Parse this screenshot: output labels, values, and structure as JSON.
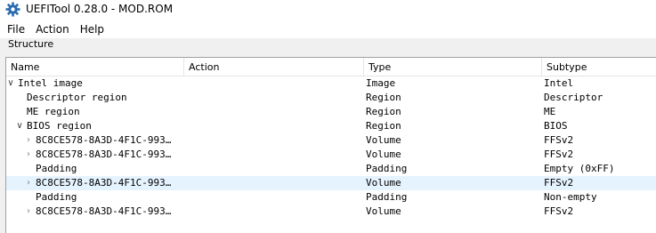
{
  "window": {
    "title": "UEFITool 0.28.0 - MOD.ROM"
  },
  "menu": {
    "items": [
      "File",
      "Action",
      "Help"
    ]
  },
  "structure": {
    "group_label": "Structure",
    "columns": [
      "Name",
      "Action",
      "Type",
      "Subtype"
    ],
    "rows": [
      {
        "name": "Intel image",
        "action": "",
        "type": "Image",
        "subtype": "Intel",
        "expander": "expanded",
        "selected": false
      },
      {
        "name": "Descriptor region",
        "action": "",
        "type": "Region",
        "subtype": "Descriptor",
        "expander": "none",
        "selected": false
      },
      {
        "name": "ME region",
        "action": "",
        "type": "Region",
        "subtype": "ME",
        "expander": "none",
        "selected": false
      },
      {
        "name": "BIOS region",
        "action": "",
        "type": "Region",
        "subtype": "BIOS",
        "expander": "expanded",
        "selected": false
      },
      {
        "name": "8C8CE578-8A3D-4F1C-993…",
        "action": "",
        "type": "Volume",
        "subtype": "FFSv2",
        "expander": "collapsed",
        "selected": false
      },
      {
        "name": "8C8CE578-8A3D-4F1C-993…",
        "action": "",
        "type": "Volume",
        "subtype": "FFSv2",
        "expander": "collapsed",
        "selected": false
      },
      {
        "name": "Padding",
        "action": "",
        "type": "Padding",
        "subtype": "Empty (0xFF)",
        "expander": "none",
        "selected": false
      },
      {
        "name": "8C8CE578-8A3D-4F1C-993…",
        "action": "",
        "type": "Volume",
        "subtype": "FFSv2",
        "expander": "collapsed",
        "selected": true
      },
      {
        "name": "Padding",
        "action": "",
        "type": "Padding",
        "subtype": "Non-empty",
        "expander": "none",
        "selected": false
      },
      {
        "name": "8C8CE578-8A3D-4F1C-993…",
        "action": "",
        "type": "Volume",
        "subtype": "FFSv2",
        "expander": "collapsed",
        "selected": false
      }
    ]
  },
  "icons": {
    "app": "gear-icon",
    "expanded": "chevron-down-icon",
    "collapsed": "chevron-right-icon"
  },
  "colors": {
    "selection": "#e5f3ff",
    "app_icon": "#2b6cb0"
  }
}
